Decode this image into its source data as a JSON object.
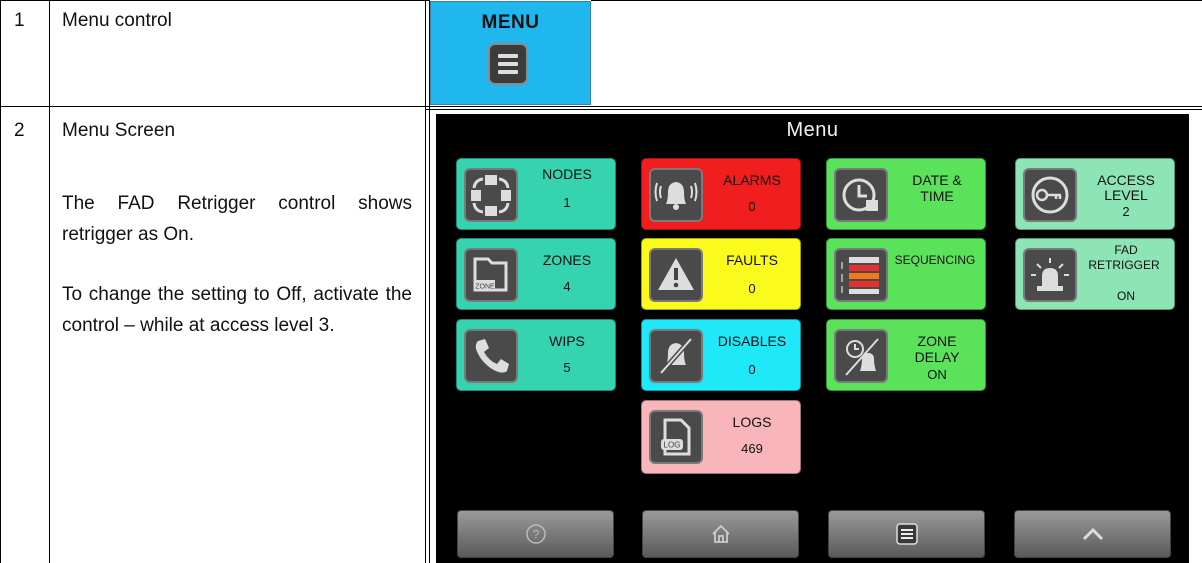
{
  "table": {
    "rows": [
      {
        "number": "1",
        "title": "Menu control",
        "paragraphs": []
      },
      {
        "number": "2",
        "title": "Menu Screen",
        "paragraphs": [
          "The FAD Retrigger control shows retrigger as On.",
          "To change the setting to Off, activate the control – while at access level 3."
        ]
      }
    ]
  },
  "menu_control": {
    "label": "MENU",
    "icon": "hamburger-icon",
    "color": "#1fb7ee"
  },
  "screen": {
    "title": "Menu",
    "tiles": {
      "nodes": {
        "label": "NODES",
        "value": "1",
        "icon": "nodes-icon",
        "color": "#35d3b0"
      },
      "zones": {
        "label": "ZONES",
        "value": "4",
        "icon": "zone-icon",
        "color": "#35d3b0"
      },
      "wips": {
        "label": "WIPS",
        "value": "5",
        "icon": "phone-icon",
        "color": "#35d3b0"
      },
      "alarms": {
        "label": "ALARMS",
        "value": "0",
        "icon": "bell-alarm-icon",
        "color": "#f01e1e"
      },
      "faults": {
        "label": "FAULTS",
        "value": "0",
        "icon": "warning-icon",
        "color": "#fafa1c"
      },
      "disables": {
        "label": "DISABLES",
        "value": "0",
        "icon": "disable-icon",
        "color": "#1fe8f8"
      },
      "logs": {
        "label": "LOGS",
        "value": "469",
        "icon": "log-icon",
        "color": "#f8b6bb"
      },
      "date_time": {
        "label_line1": "DATE &",
        "label_line2": "TIME",
        "icon": "clock-calendar-icon",
        "color": "#5be25b"
      },
      "sequencing": {
        "label": "SEQUENCING",
        "icon": "sequencing-icon",
        "color": "#5be25b"
      },
      "zone_delay": {
        "label_line1": "ZONE",
        "label_line2": "DELAY",
        "value": "ON",
        "icon": "zone-delay-icon",
        "color": "#5be25b"
      },
      "access_level": {
        "label_line1": "ACCESS",
        "label_line2": "LEVEL",
        "value": "2",
        "icon": "key-icon",
        "color": "#8de4b4"
      },
      "fad_retrigger": {
        "label_line1": "FAD",
        "label_line2": "RETRIGGER",
        "value": "ON",
        "icon": "beacon-icon",
        "color": "#8de4b4"
      }
    },
    "nav": [
      {
        "name": "help",
        "icon": "help-icon"
      },
      {
        "name": "home",
        "icon": "home-icon"
      },
      {
        "name": "menu",
        "icon": "hamburger-icon"
      },
      {
        "name": "up",
        "icon": "chevron-up-icon"
      }
    ]
  }
}
